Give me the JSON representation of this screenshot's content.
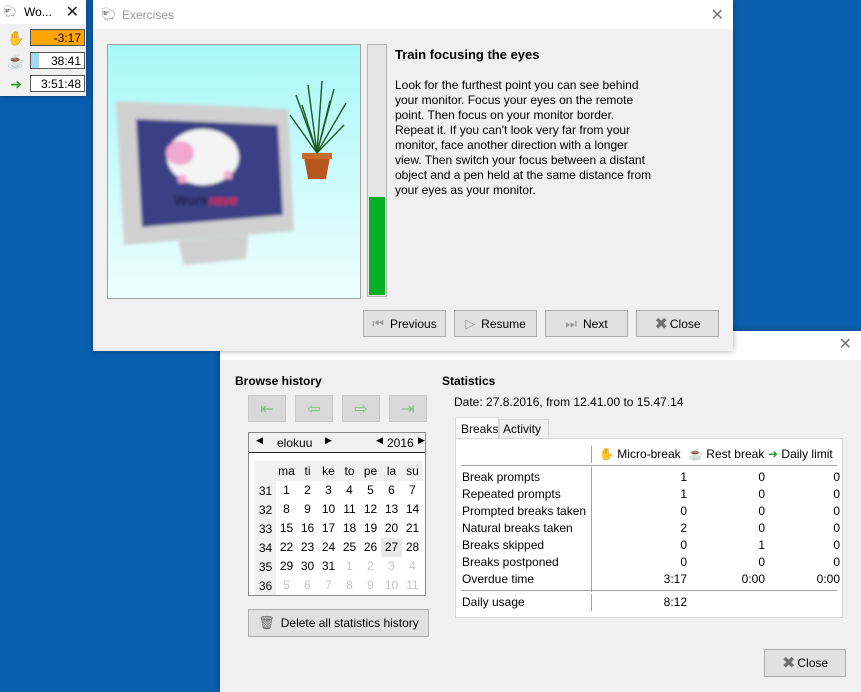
{
  "mini_window": {
    "title": "Wo...",
    "rows": [
      {
        "icon": "hand-icon",
        "value": "-3:17",
        "fill_fraction": 1.0,
        "fill_color": "#ffa500"
      },
      {
        "icon": "coffee-cup-icon",
        "value": "38:41",
        "fill_fraction": 0.15,
        "fill_color": "#a6d8f0"
      },
      {
        "icon": "exit-door-icon",
        "value": "3:51:48",
        "fill_fraction": 0.0,
        "fill_color": "#ffffff"
      }
    ]
  },
  "exercises": {
    "title": "Exercises",
    "image_caption": "Workrave",
    "progress_fraction": 0.4,
    "exercise_title": "Train focusing the eyes",
    "exercise_text": "Look for the furthest point you can see behind your monitor. Focus your eyes on the remote point. Then focus on your monitor border. Repeat it. If you can't look very far from your monitor, face another direction with a longer view. Then switch your focus between a distant object and a pen held at the same distance from your eyes as your monitor.",
    "buttons": {
      "previous": "Previous",
      "resume": "Resume",
      "next": "Next",
      "close": "Close"
    }
  },
  "statistics_window": {
    "browse_history_label": "Browse history",
    "statistics_label": "Statistics",
    "date_line": "Date:  27.8.2016, from 12.41.00 to 15.47.14",
    "calendar": {
      "month": "elokuu",
      "year": "2016",
      "weekdays": [
        "ma",
        "ti",
        "ke",
        "to",
        "pe",
        "la",
        "su"
      ],
      "weeks": [
        {
          "week": "31",
          "days": [
            {
              "d": "1"
            },
            {
              "d": "2"
            },
            {
              "d": "3"
            },
            {
              "d": "4"
            },
            {
              "d": "5"
            },
            {
              "d": "6"
            },
            {
              "d": "7"
            }
          ]
        },
        {
          "week": "32",
          "days": [
            {
              "d": "8"
            },
            {
              "d": "9"
            },
            {
              "d": "10"
            },
            {
              "d": "11"
            },
            {
              "d": "12"
            },
            {
              "d": "13"
            },
            {
              "d": "14"
            }
          ]
        },
        {
          "week": "33",
          "days": [
            {
              "d": "15"
            },
            {
              "d": "16"
            },
            {
              "d": "17"
            },
            {
              "d": "18"
            },
            {
              "d": "19"
            },
            {
              "d": "20"
            },
            {
              "d": "21"
            }
          ]
        },
        {
          "week": "34",
          "days": [
            {
              "d": "22"
            },
            {
              "d": "23"
            },
            {
              "d": "24"
            },
            {
              "d": "25"
            },
            {
              "d": "26"
            },
            {
              "d": "27",
              "selected": true
            },
            {
              "d": "28"
            }
          ]
        },
        {
          "week": "35",
          "days": [
            {
              "d": "29"
            },
            {
              "d": "30"
            },
            {
              "d": "31"
            },
            {
              "d": "1",
              "other": true
            },
            {
              "d": "2",
              "other": true
            },
            {
              "d": "3",
              "other": true
            },
            {
              "d": "4",
              "other": true
            }
          ]
        },
        {
          "week": "36",
          "days": [
            {
              "d": "5",
              "other": true
            },
            {
              "d": "6",
              "other": true
            },
            {
              "d": "7",
              "other": true
            },
            {
              "d": "8",
              "other": true
            },
            {
              "d": "9",
              "other": true
            },
            {
              "d": "10",
              "other": true
            },
            {
              "d": "11",
              "other": true
            }
          ]
        }
      ]
    },
    "delete_button": "Delete all statistics history",
    "tabs": [
      "Breaks",
      "Activity"
    ],
    "columns": [
      "Micro-break",
      "Rest break",
      "Daily limit"
    ],
    "rows": [
      {
        "label": "Break prompts",
        "micro": "1",
        "rest": "0",
        "daily": "0"
      },
      {
        "label": "Repeated prompts",
        "micro": "1",
        "rest": "0",
        "daily": "0"
      },
      {
        "label": "Prompted breaks taken",
        "micro": "0",
        "rest": "0",
        "daily": "0"
      },
      {
        "label": "Natural breaks taken",
        "micro": "2",
        "rest": "0",
        "daily": "0"
      },
      {
        "label": "Breaks skipped",
        "micro": "0",
        "rest": "1",
        "daily": "0"
      },
      {
        "label": "Breaks postponed",
        "micro": "0",
        "rest": "0",
        "daily": "0"
      },
      {
        "label": "Overdue time",
        "micro": "3:17",
        "rest": "0:00",
        "daily": "0:00"
      }
    ],
    "daily_usage": {
      "label": "Daily usage",
      "value": "8:12"
    },
    "close_button": "Close"
  }
}
